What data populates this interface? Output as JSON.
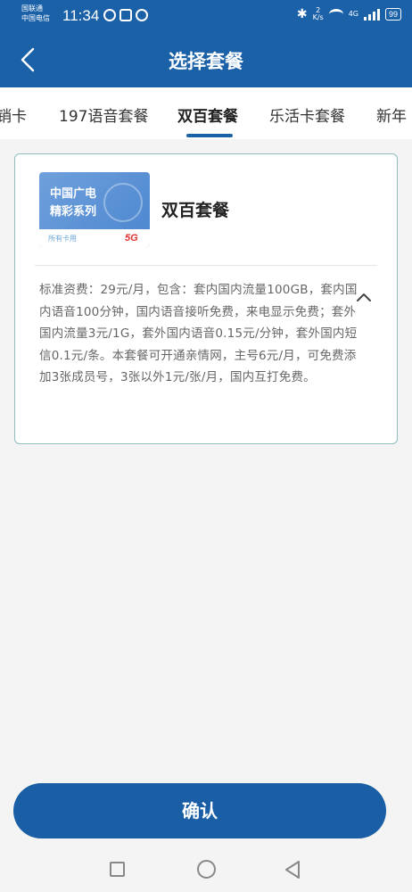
{
  "status_bar": {
    "carrier_line1": "国联通",
    "carrier_line2": "中国电信",
    "time": "11:34",
    "speed_top": "2",
    "speed_bottom": "K/s",
    "network": "4G",
    "battery": "99"
  },
  "header": {
    "title": "选择套餐"
  },
  "tabs": [
    {
      "label": "销卡"
    },
    {
      "label": "197语音套餐"
    },
    {
      "label": "双百套餐",
      "active": true
    },
    {
      "label": "乐活卡套餐"
    },
    {
      "label": "新年"
    }
  ],
  "plan_card": {
    "image": {
      "line1": "中国广电",
      "line2": "精彩系列",
      "strip_text": "所有卡用",
      "badge": "5G"
    },
    "name": "双百套餐",
    "description": "标准资费：29元/月，包含：套内国内流量100GB，套内国内语音100分钟，国内语音接听免费，来电显示免费；套外国内流量3元/1G，套外国内语音0.15元/分钟，套外国内短信0.1元/条。本套餐可开通亲情网，主号6元/月，可免费添加3张成员号，3张以外1元/张/月，国内互打免费。",
    "toggle_icon": "chevron-up-icon"
  },
  "footer": {
    "confirm_label": "确认"
  },
  "colors": {
    "brand_blue": "#1b61a8",
    "card_border": "#8fbcbd"
  }
}
